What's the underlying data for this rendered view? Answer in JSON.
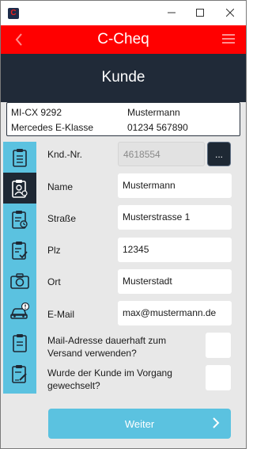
{
  "window": {
    "icon": "c-cheq-app-icon",
    "controls": [
      "minimize-icon",
      "maximize-icon",
      "close-icon"
    ]
  },
  "header": {
    "title": "C-Cheq",
    "back_icon": "chevron-left-icon",
    "menu_icon": "hamburger-menu-icon",
    "color": "#ff0000"
  },
  "page": {
    "title": "Kunde"
  },
  "vehicle": {
    "plate": "MI-CX 9292",
    "model": "Mercedes E-Klasse",
    "customer_name": "Mustermann",
    "phone": "01234 567890"
  },
  "sidebar": {
    "items": [
      {
        "icon": "clipboard-icon",
        "active": false
      },
      {
        "icon": "clipboard-person-icon",
        "active": true
      },
      {
        "icon": "clipboard-clock-icon",
        "active": false
      },
      {
        "icon": "clipboard-check-icon",
        "active": false
      },
      {
        "icon": "camera-icon",
        "active": false
      },
      {
        "icon": "car-alert-icon",
        "active": false
      },
      {
        "icon": "clipboard-list-icon",
        "active": false
      },
      {
        "icon": "clipboard-edit-icon",
        "active": false
      }
    ],
    "color": "#5bc2e0",
    "active_color": "#1e2834"
  },
  "form": {
    "customer_no": {
      "label": "Knd.-Nr.",
      "value": "4618554",
      "lookup_label": "..."
    },
    "name": {
      "label": "Name",
      "value": "Mustermann"
    },
    "street": {
      "label": "Straße",
      "value": "Musterstrasse 1"
    },
    "zip": {
      "label": "Plz",
      "value": "12345"
    },
    "city": {
      "label": "Ort",
      "value": "Musterstadt"
    },
    "email": {
      "label": "E-Mail",
      "value": "max@mustermann.de"
    },
    "use_mail_permanently": {
      "label": "Mail-Adresse dauerhaft zum Versand verwenden?",
      "checked": false
    },
    "customer_changed": {
      "label": "Wurde der Kunde im Vorgang gewechselt?",
      "checked": false
    }
  },
  "actions": {
    "next_label": "Weiter",
    "next_icon": "chevron-right-icon"
  }
}
